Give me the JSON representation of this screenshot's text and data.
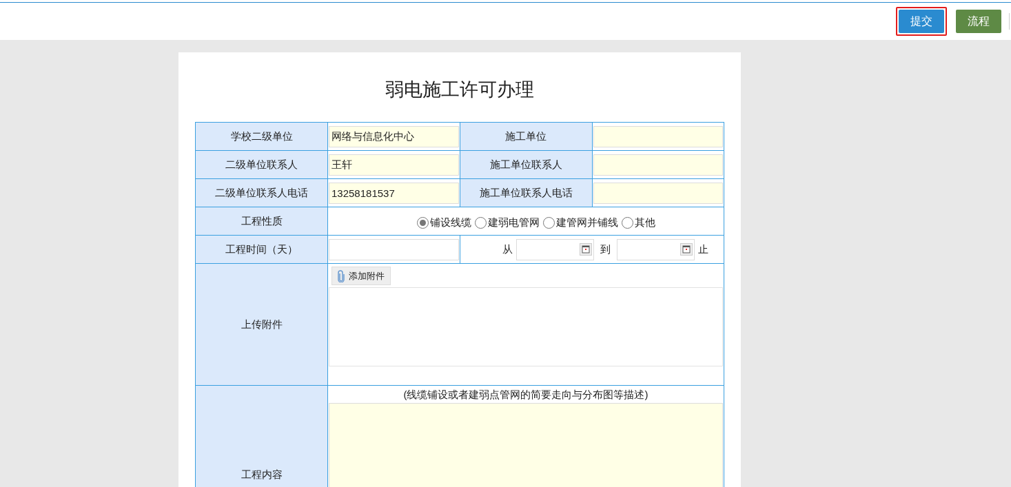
{
  "toolbar": {
    "buttons": [
      {
        "label": "提交",
        "kind": "primary",
        "highlighted": true
      },
      {
        "label": "流程",
        "kind": "secondary",
        "highlighted": false
      }
    ]
  },
  "form": {
    "title": "弱电施工许可办理",
    "pairs": [
      {
        "label": "学校二级单位",
        "value": "网络与信息化中心",
        "label2": "施工单位"
      },
      {
        "label": "二级单位联系人",
        "value": "王轩",
        "label2": "施工单位联系人"
      },
      {
        "label": "二级单位联系人电话",
        "value": "13258181537",
        "label2": "施工单位联系人电话"
      }
    ],
    "nature": {
      "label": "工程性质",
      "options": [
        {
          "label": "铺设线缆",
          "selected": true
        },
        {
          "label": "建弱电管网",
          "selected": false
        },
        {
          "label": "建管网并铺线",
          "selected": false
        },
        {
          "label": "其他",
          "selected": false
        }
      ]
    },
    "duration": {
      "label": "工程时间（天）",
      "from_label": "从",
      "to_label": "到",
      "end_label": "止"
    },
    "upload": {
      "label": "上传附件",
      "button": "添加附件"
    },
    "content": {
      "label": "工程内容",
      "hint": "(线缆铺设或者建弱点管网的简要走向与分布图等描述)"
    }
  }
}
